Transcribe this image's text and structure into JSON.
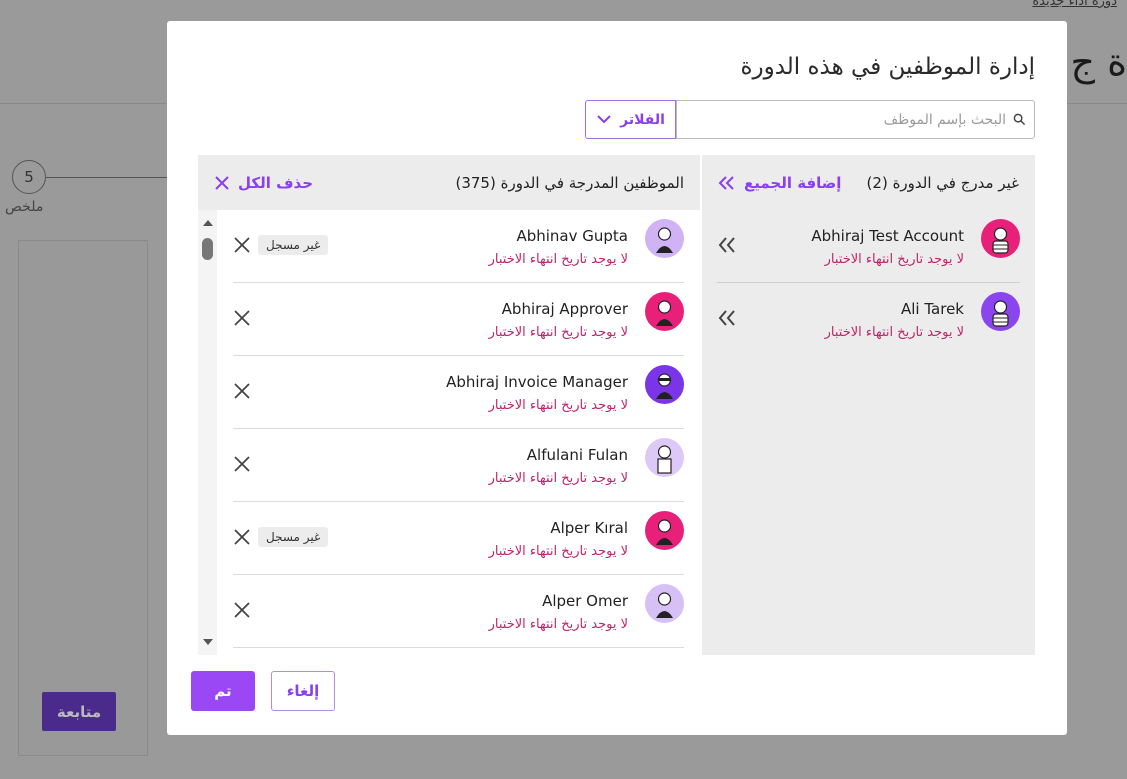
{
  "background": {
    "top_link": "دوره أداء جديدة",
    "title": "ة ج",
    "step_number": "5",
    "step_label": "ملخص",
    "continue_label": "متابعة"
  },
  "modal": {
    "title": "إدارة الموظفين في هذه الدورة",
    "search_placeholder": "البحث بإسم الموظف",
    "filters_label": "الفلاتر",
    "included": {
      "title": "الموظفين المدرجة في الدورة (375)",
      "remove_all_label": "حذف الكل",
      "rows": [
        {
          "name": "Abhinav Gupta",
          "sub": "لا يوجد تاريخ انتهاء الاختبار",
          "badge": "غير مسجل",
          "avatar_bg": "#cfb3f5"
        },
        {
          "name": "Abhiraj Approver",
          "sub": "لا يوجد تاريخ انتهاء الاختبار",
          "badge": "",
          "avatar_bg": "#e8207a"
        },
        {
          "name": "Abhiraj Invoice Manager",
          "sub": "لا يوجد تاريخ انتهاء الاختبار",
          "badge": "",
          "avatar_bg": "#7b35e8"
        },
        {
          "name": "Alfulani Fulan",
          "sub": "لا يوجد تاريخ انتهاء الاختبار",
          "badge": "",
          "avatar_bg": "#dcc9f7"
        },
        {
          "name": "Alper Kıral",
          "sub": "لا يوجد تاريخ انتهاء الاختبار",
          "badge": "غير مسجل",
          "avatar_bg": "#e8207a"
        },
        {
          "name": "Alper Omer",
          "sub": "لا يوجد تاريخ انتهاء الاختبار",
          "badge": "",
          "avatar_bg": "#d7c0f6"
        }
      ]
    },
    "excluded": {
      "title": "غير مدرج في الدورة (2)",
      "add_all_label": "إضافة الجميع",
      "rows": [
        {
          "name": "Abhiraj Test Account",
          "sub": "لا يوجد تاريخ انتهاء الاختبار",
          "avatar_bg": "#e8207a"
        },
        {
          "name": "Ali Tarek",
          "sub": "لا يوجد تاريخ انتهاء الاختبار",
          "avatar_bg": "#8a45ee"
        }
      ]
    },
    "done_label": "تم",
    "cancel_label": "إلغاء"
  },
  "colors": {
    "accent": "#9a47f5",
    "subtext": "#c0246b",
    "panel_bg": "#ececec"
  }
}
